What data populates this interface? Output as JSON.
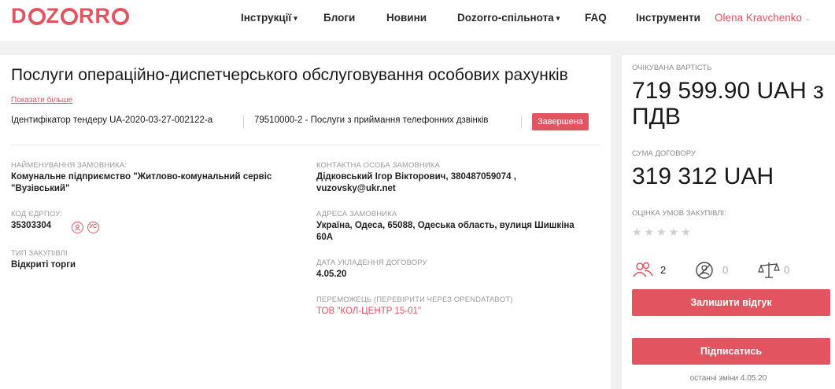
{
  "brand": {
    "logo": "DOZORRO",
    "accent": "#e15460"
  },
  "nav": {
    "items": [
      {
        "label": "Інструкції",
        "has_dropdown": true
      },
      {
        "label": "Блоги",
        "has_dropdown": false
      },
      {
        "label": "Новини",
        "has_dropdown": false
      },
      {
        "label": "Dozorro-спільнота",
        "has_dropdown": true
      },
      {
        "label": "FAQ",
        "has_dropdown": false
      },
      {
        "label": "Інструменти",
        "has_dropdown": false
      }
    ],
    "user": "Olena Kravchenko",
    "caret": "▾",
    "user_caret": "⌄"
  },
  "tender": {
    "title": "Послуги операційно-диспетчерського обслуговування особових рахунків",
    "show_more": "Показати більше",
    "identifier": "Ідентифікатор тендеру UA-2020-03-27-002122-a",
    "cpv": "79510000-2 - Послуги з приймання телефонних дзвінків",
    "status": "Завершена"
  },
  "details": {
    "customer_label": "НАЙМЕНУВАННЯ ЗАМОВНИКА:",
    "customer_value": "Комунальне підприємство \"Житлово-комунальний сервіс \"Вузівський\"",
    "edrpou_label": "КОД ЄДРПОУ:",
    "edrpou_value": "35303304",
    "procurement_type_label": "ТИП ЗАКУПІВЛІ",
    "procurement_type_value": "Відкриті торги",
    "contact_label": "КОНТАКТНА ОСОБА ЗАМОВНИКА",
    "contact_value": "Дідковський Ігор Вікторович, 380487059074 , vuzovsky@ukr.net",
    "address_label": "АДРЕСА ЗАМОВНИКА",
    "address_value": "Україна, Одеса, 65088, Одеська область, вулиця Шишкіна 60А",
    "contract_date_label": "ДАТА УКЛАДЕННЯ ДОГОВОРУ",
    "contract_date_value": "4.05.20",
    "winner_label": "ПЕРЕМОЖЕЦЬ (ПЕРЕВІРИТИ ЧЕРЕЗ OPENDATABOT)",
    "winner_value": "ТОВ \"КОЛ-ЦЕНТР 15-01\""
  },
  "sidebar": {
    "expected_label": "ОЧІКУВАНА ВАРТІСТЬ",
    "expected_value": "719 599.90 UAH з ПДВ",
    "contract_sum_label": "СУМА ДОГОВОРУ",
    "contract_sum_value": "319 312 UAH",
    "rating_label": "ОЦІНКА УМОВ ЗАКУПІВЛІ:",
    "rating_stars": "★★★★★",
    "stats": {
      "participants": "2",
      "complaints": "0",
      "disputes": "0"
    },
    "feedback_button": "Залишити відгук",
    "subscribe_button": "Підписатись",
    "last_change": "останні зміни 4.05.20"
  }
}
